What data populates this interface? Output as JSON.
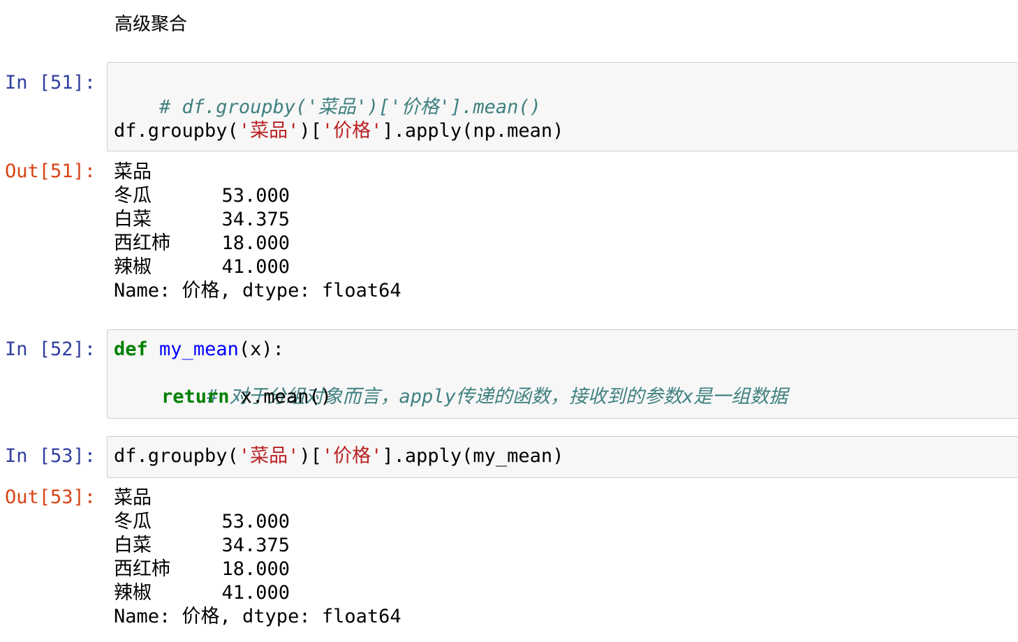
{
  "markdown": {
    "heading": "高级聚合"
  },
  "cells": {
    "c51": {
      "in_prompt": "In [51]:",
      "line1": "# df.groupby('菜品')['价格'].mean()",
      "line2": {
        "p1": "df.groupby(",
        "s1": "'菜品'",
        "p2": ")[",
        "s2": "'价格'",
        "p3": "].apply(np.mean)"
      },
      "out_prompt": "Out[51]:",
      "output": {
        "index_name": "菜品",
        "rows": [
          {
            "label": "冬瓜",
            "value": "53.000"
          },
          {
            "label": "白菜",
            "value": "34.375"
          },
          {
            "label": "西红柿",
            "value": "18.000"
          },
          {
            "label": "辣椒",
            "value": "41.000"
          }
        ],
        "footer": "Name: 价格, dtype: float64"
      }
    },
    "c52": {
      "in_prompt": "In [52]:",
      "kw_def": "def",
      "fname": "my_mean",
      "sig": "(x):",
      "comment": "# 对于分组对象而言，apply传递的函数，接收到的参数x是一组数据",
      "kw_return": "return",
      "ret_expr": " x.mean()"
    },
    "c53": {
      "in_prompt": "In [53]:",
      "line": {
        "p1": "df.groupby(",
        "s1": "'菜品'",
        "p2": ")[",
        "s2": "'价格'",
        "p3": "].apply(my_mean)"
      },
      "out_prompt": "Out[53]:",
      "output": {
        "index_name": "菜品",
        "rows": [
          {
            "label": "冬瓜",
            "value": "53.000"
          },
          {
            "label": "白菜",
            "value": "34.375"
          },
          {
            "label": "西红柿",
            "value": "18.000"
          },
          {
            "label": "辣椒",
            "value": "41.000"
          }
        ],
        "footer": "Name: 价格, dtype: float64"
      }
    }
  }
}
